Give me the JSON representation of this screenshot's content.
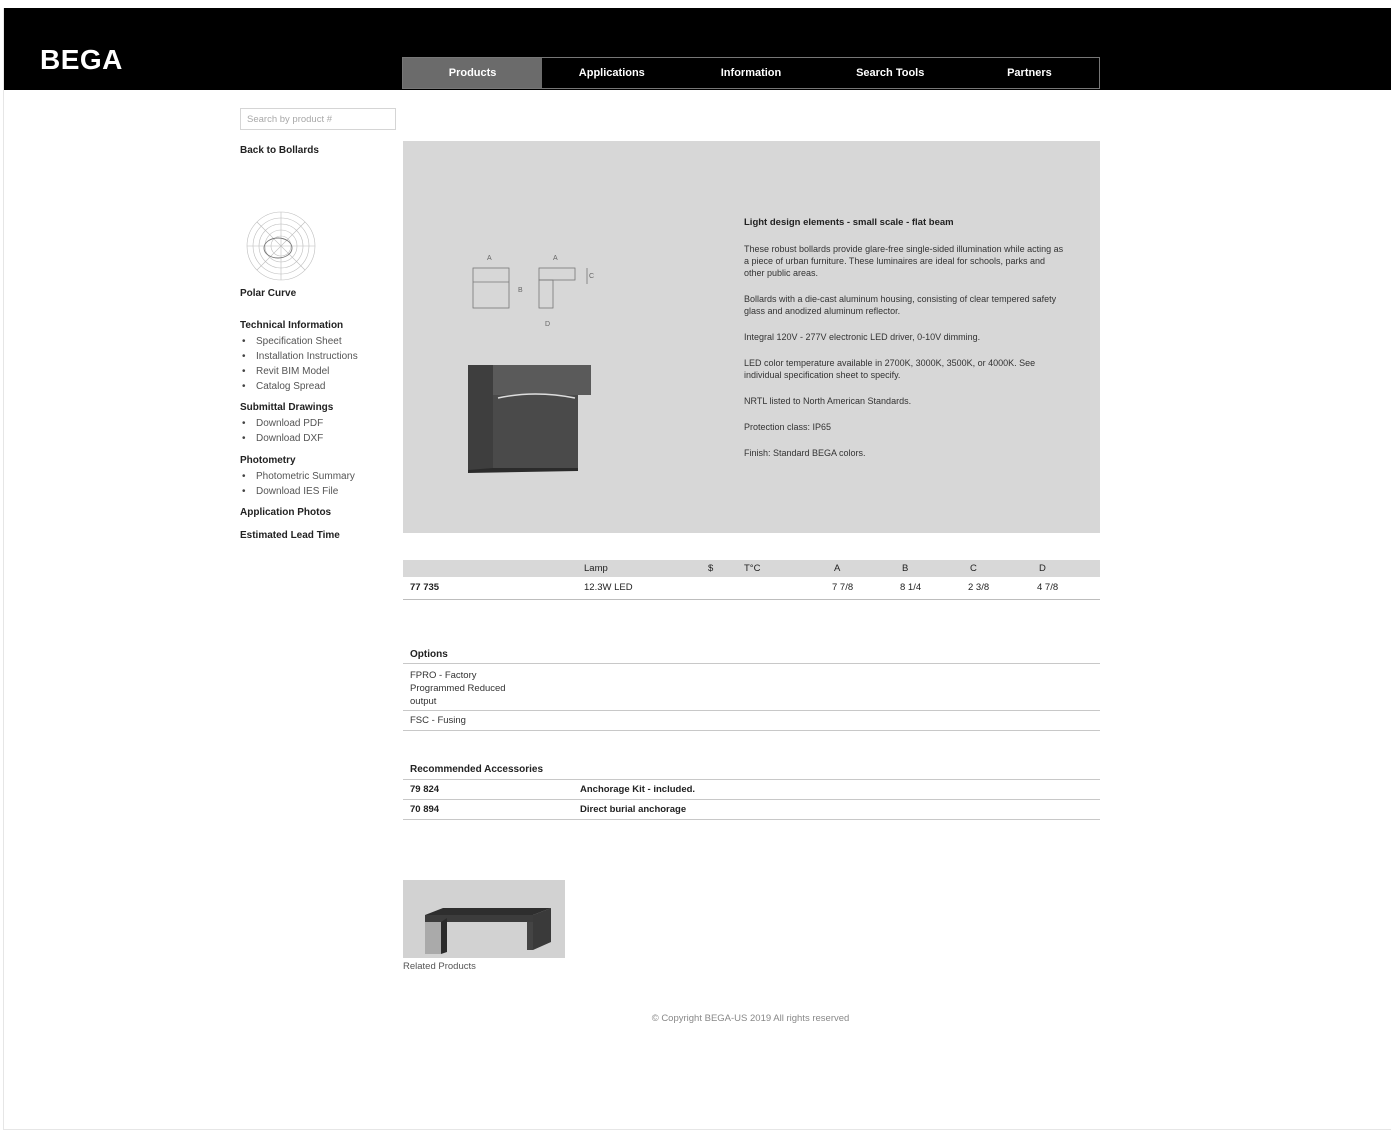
{
  "brand": {
    "logo": "BEGA"
  },
  "nav": {
    "items": [
      {
        "label": "Products",
        "active": true
      },
      {
        "label": "Applications",
        "active": false
      },
      {
        "label": "Information",
        "active": false
      },
      {
        "label": "Search Tools",
        "active": false
      },
      {
        "label": "Partners",
        "active": false
      }
    ]
  },
  "sidebar": {
    "search_placeholder": "Search by product #",
    "back_link": "Back to Bollards",
    "polar_label": "Polar Curve",
    "technical": {
      "title": "Technical Information",
      "items": [
        "Specification Sheet",
        "Installation Instructions",
        "Revit BIM Model",
        "Catalog Spread"
      ]
    },
    "submittal": {
      "title": "Submittal Drawings",
      "items": [
        "Download PDF",
        "Download DXF"
      ]
    },
    "photometry": {
      "title": "Photometry",
      "items": [
        "Photometric Summary",
        "Download IES File"
      ]
    },
    "application_photos": "Application Photos",
    "lead_time": "Estimated Lead Time"
  },
  "hero": {
    "dim_labels": {
      "a": "A",
      "b": "B",
      "c": "C",
      "d": "D"
    },
    "title": "Light design elements - small scale - flat beam",
    "paragraphs": [
      "These robust bollards provide glare-free single-sided illumination while acting as a piece of urban furniture. These luminaires are ideal for schools, parks and other public areas.",
      "Bollards with a die-cast aluminum housing, consisting of clear tempered safety glass and anodized aluminum reflector.",
      "Integral 120V - 277V electronic LED driver, 0-10V dimming.",
      "LED color temperature available in 2700K, 3000K, 3500K, or 4000K. See individual specification sheet to specify.",
      "NRTL listed to North American Standards.",
      "Protection class: IP65",
      "Finish: Standard BEGA colors."
    ]
  },
  "spec_table": {
    "headers": {
      "lamp": "Lamp",
      "s": "$",
      "tc": "T°C",
      "a": "A",
      "b": "B",
      "c": "C",
      "d": "D"
    },
    "row": {
      "model": "77 735",
      "lamp": "12.3W LED",
      "a": "7 7/8",
      "b": "8 1/4",
      "c": "2 3/8",
      "d": "4 7/8"
    }
  },
  "options": {
    "title": "Options",
    "items": [
      "FPRO - Factory Programmed Reduced output",
      "FSC - Fusing"
    ]
  },
  "accessories": {
    "title": "Recommended Accessories",
    "items": [
      {
        "number": "79 824",
        "name": "Anchorage Kit - included."
      },
      {
        "number": "70 894",
        "name": "Direct burial anchorage"
      }
    ]
  },
  "related": {
    "label": "Related Products"
  },
  "footer": {
    "copyright": "© Copyright BEGA-US 2019 All rights reserved"
  }
}
